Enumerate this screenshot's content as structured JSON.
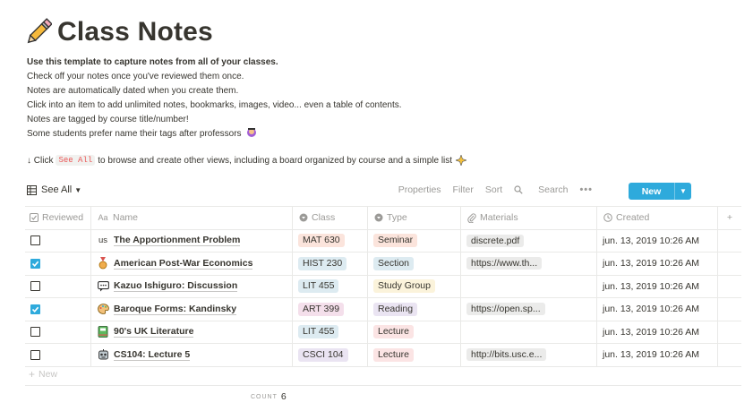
{
  "page": {
    "title": "Class Notes",
    "title_icon": "pencil-icon",
    "description": [
      "Use this template to capture notes from all of your classes.",
      "Check off your notes once you've reviewed them once.",
      "Notes are automatically dated when you create them.",
      "Click into an item to add unlimited notes, bookmarks, images, video... even a table of contents.",
      "Notes are tagged by course title/number!",
      "Some students prefer name their tags after professors"
    ],
    "hint_prefix": "↓ Click",
    "hint_code": "See All",
    "hint_suffix": "to browse and create other views, including a board organized by course and a simple list"
  },
  "view": {
    "label": "See All",
    "toolbar": [
      "Properties",
      "Filter",
      "Sort",
      "Search"
    ],
    "more": "•••",
    "new_label": "New"
  },
  "columns": {
    "reviewed": "Reviewed",
    "name": "Name",
    "class": "Class",
    "type": "Type",
    "materials": "Materials",
    "created": "Created"
  },
  "rows": [
    {
      "reviewed": false,
      "icon": "us",
      "name": "The Apportionment Problem",
      "class": "MAT 630",
      "class_color": "#fbe4dc",
      "type": "Seminar",
      "type_color": "#fbe4dc",
      "materials": "discrete.pdf",
      "created": "jun. 13, 2019 10:26 AM"
    },
    {
      "reviewed": true,
      "icon": "medal-icon",
      "name": "American Post-War Economics",
      "class": "HIST 230",
      "class_color": "#ddebf1",
      "type": "Section",
      "type_color": "#ddebf1",
      "materials": "https://www.th...",
      "created": "jun. 13, 2019 10:26 AM"
    },
    {
      "reviewed": false,
      "icon": "speech-icon",
      "name": "Kazuo Ishiguro: Discussion",
      "class": "LIT 455",
      "class_color": "#ddebf1",
      "type": "Study Group",
      "type_color": "#fbf3db",
      "materials": "",
      "created": "jun. 13, 2019 10:26 AM"
    },
    {
      "reviewed": true,
      "icon": "palette-icon",
      "name": "Baroque Forms: Kandinsky",
      "class": "ART 399",
      "class_color": "#f4dfeb",
      "type": "Reading",
      "type_color": "#eae4f2",
      "materials": "https://open.sp...",
      "created": "jun. 13, 2019 10:26 AM"
    },
    {
      "reviewed": false,
      "icon": "book-icon",
      "name": "90's UK Literature",
      "class": "LIT 455",
      "class_color": "#ddebf1",
      "type": "Lecture",
      "type_color": "#fbe4e4",
      "materials": "",
      "created": "jun. 13, 2019 10:26 AM"
    },
    {
      "reviewed": false,
      "icon": "robot-icon",
      "name": "CS104: Lecture 5",
      "class": "CSCI 104",
      "class_color": "#eae4f2",
      "type": "Lecture",
      "type_color": "#fbe4e4",
      "materials": "http://bits.usc.e...",
      "created": "jun. 13, 2019 10:26 AM"
    }
  ],
  "footer": {
    "new_row": "New",
    "count_label": "COUNT",
    "count_value": "6"
  },
  "colors": {
    "accent": "#2eaadc",
    "code_text": "#eb5757",
    "muted": "#9b9a97"
  }
}
